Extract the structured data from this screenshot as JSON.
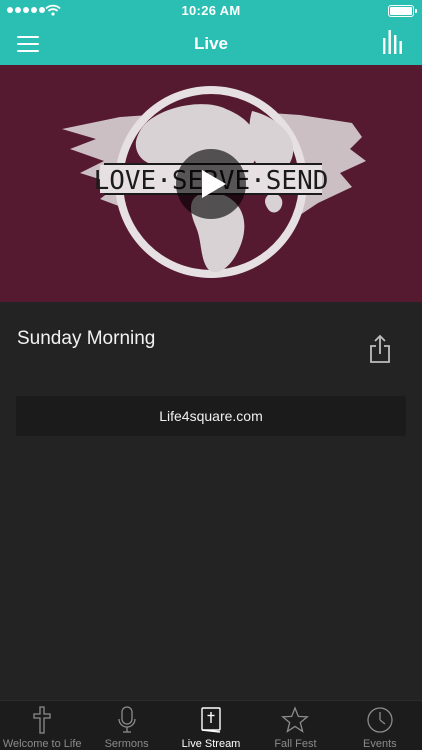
{
  "status_bar": {
    "time": "10:26 AM"
  },
  "nav": {
    "title": "Live"
  },
  "hero": {
    "artwork_text": "LOVE·SERVE·SEND"
  },
  "content": {
    "title": "Sunday Morning",
    "link_label": "Life4square.com"
  },
  "tabs": [
    {
      "label": "Welcome to Life",
      "icon": "cross-icon",
      "active": false
    },
    {
      "label": "Sermons",
      "icon": "microphone-icon",
      "active": false
    },
    {
      "label": "Live Stream",
      "icon": "bible-icon",
      "active": true
    },
    {
      "label": "Fall Fest",
      "icon": "star-icon",
      "active": false
    },
    {
      "label": "Events",
      "icon": "clock-icon",
      "active": false
    }
  ],
  "colors": {
    "accent": "#2bbfb3",
    "hero_bg": "#561a30",
    "background": "#232323",
    "tabbar_bg": "#1c1c1c"
  }
}
